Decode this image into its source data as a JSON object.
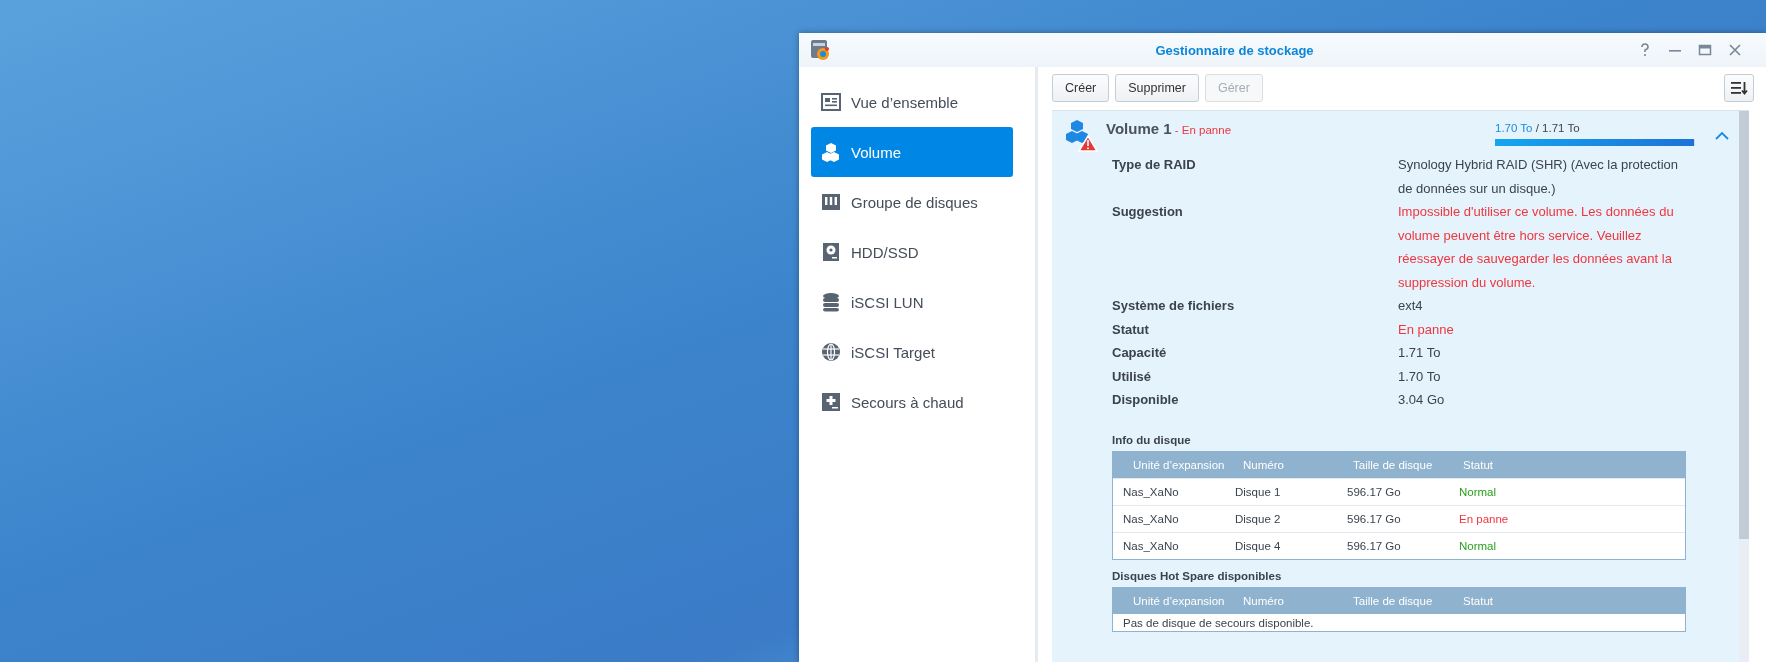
{
  "window": {
    "title": "Gestionnaire de stockage"
  },
  "sidebar": {
    "items": [
      {
        "label": "Vue d’ensemble",
        "selected": false
      },
      {
        "label": "Volume",
        "selected": true
      },
      {
        "label": "Groupe de disques",
        "selected": false
      },
      {
        "label": "HDD/SSD",
        "selected": false
      },
      {
        "label": "iSCSI LUN",
        "selected": false
      },
      {
        "label": "iSCSI Target",
        "selected": false
      },
      {
        "label": "Secours à chaud",
        "selected": false
      }
    ]
  },
  "toolbar": {
    "buttons": [
      {
        "label": "Créer",
        "disabled": false
      },
      {
        "label": "Supprimer",
        "disabled": false
      },
      {
        "label": "Gérer",
        "disabled": true
      }
    ]
  },
  "volume": {
    "name": "Volume 1",
    "separator": " - ",
    "status": "En panne",
    "failed": true,
    "used": "1.70 To",
    "sep2": " / ",
    "total": "1.71 To",
    "level": 0.994,
    "expanded": true,
    "details": [
      {
        "label": "Type de RAID",
        "value": "Synology Hybrid RAID (SHR) (Avec la protection de données sur un disque.)",
        "alert": false
      },
      {
        "label": "Suggestion",
        "value": "Impossible d'utiliser ce volume. Les données du volume peuvent être hors service. Veuillez réessayer de sauvegarder les données avant la suppression du volume.",
        "alert": true
      },
      {
        "label": "Système de fichiers",
        "value": "ext4",
        "alert": false
      },
      {
        "label": "Statut",
        "value": "En panne",
        "alert": true
      },
      {
        "label": "Capacité",
        "value": "1.71 To",
        "alert": false
      },
      {
        "label": "Utilisé",
        "value": "1.70 To",
        "alert": false
      },
      {
        "label": "Disponible",
        "value": "3.04 Go",
        "alert": false
      }
    ],
    "disk_info": {
      "title": "Info du disque",
      "columns": [
        "Unité d’expansion",
        "Numéro",
        "Taille de disque",
        "Statut"
      ],
      "rows": [
        {
          "unit": "Nas_XaNo",
          "number": "Disque 1",
          "size": "596.17 Go",
          "status": "Normal",
          "failed": false
        },
        {
          "unit": "Nas_XaNo",
          "number": "Disque 2",
          "size": "596.17 Go",
          "status": "En panne",
          "failed": true
        },
        {
          "unit": "Nas_XaNo",
          "number": "Disque 4",
          "size": "596.17 Go",
          "status": "Normal",
          "failed": false
        }
      ]
    },
    "hot_spare": {
      "title": "Disques Hot Spare disponibles",
      "columns": [
        "Unité d’expansion",
        "Numéro",
        "Taille de disque",
        "Statut"
      ],
      "empty": "Pas de disque de secours disponible."
    }
  }
}
